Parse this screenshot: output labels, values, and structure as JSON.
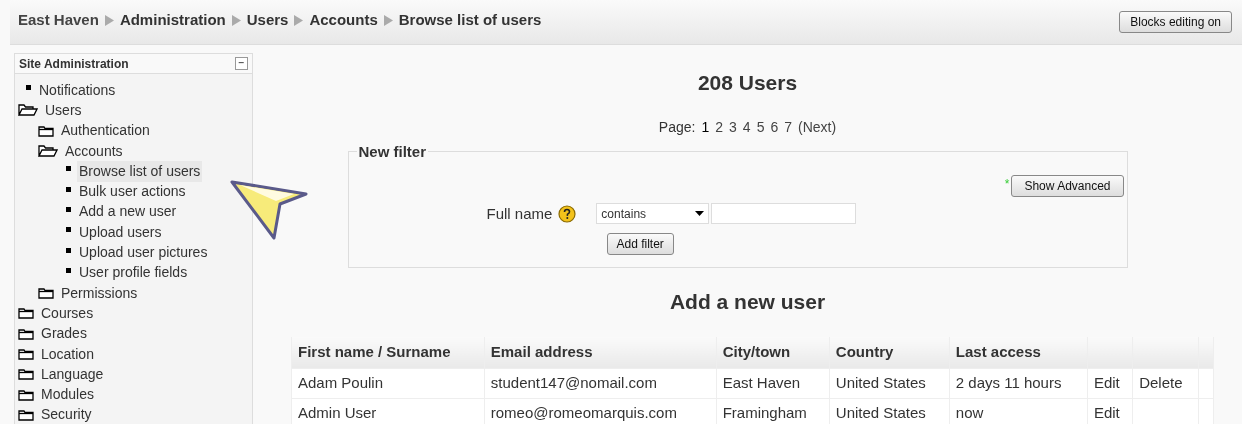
{
  "breadcrumb": [
    {
      "label": "East Haven",
      "kind": "link"
    },
    {
      "label": "Administration",
      "kind": "current"
    },
    {
      "label": "Users",
      "kind": "current"
    },
    {
      "label": "Accounts",
      "kind": "current"
    },
    {
      "label": "Browse list of users",
      "kind": "current"
    }
  ],
  "edit_button": "Blocks editing on",
  "sidebar": {
    "title": "Site Administration",
    "collapse_symbol": "−",
    "items": [
      {
        "label": "Notifications",
        "kind": "leaf",
        "selected": false
      },
      {
        "label": "Users",
        "kind": "folder",
        "expanded": true,
        "children": [
          {
            "label": "Authentication",
            "kind": "folder",
            "expanded": false
          },
          {
            "label": "Accounts",
            "kind": "folder",
            "expanded": true,
            "children": [
              {
                "label": "Browse list of users",
                "kind": "leaf",
                "selected": true
              },
              {
                "label": "Bulk user actions",
                "kind": "leaf",
                "selected": false
              },
              {
                "label": "Add a new user",
                "kind": "leaf",
                "selected": false
              },
              {
                "label": "Upload users",
                "kind": "leaf",
                "selected": false
              },
              {
                "label": "Upload user pictures",
                "kind": "leaf",
                "selected": false
              },
              {
                "label": "User profile fields",
                "kind": "leaf",
                "selected": false
              }
            ]
          },
          {
            "label": "Permissions",
            "kind": "folder",
            "expanded": false
          }
        ]
      },
      {
        "label": "Courses",
        "kind": "folder",
        "expanded": false
      },
      {
        "label": "Grades",
        "kind": "folder",
        "expanded": false
      },
      {
        "label": "Location",
        "kind": "folder",
        "expanded": false
      },
      {
        "label": "Language",
        "kind": "folder",
        "expanded": false
      },
      {
        "label": "Modules",
        "kind": "folder",
        "expanded": false
      },
      {
        "label": "Security",
        "kind": "folder",
        "expanded": false
      }
    ]
  },
  "heading": "208 Users",
  "pagination": {
    "label": "Page:",
    "pages": [
      {
        "label": "1",
        "selected": true
      },
      {
        "label": "2",
        "selected": false
      },
      {
        "label": "3",
        "selected": false
      },
      {
        "label": "4",
        "selected": false
      },
      {
        "label": "5",
        "selected": false
      },
      {
        "label": "6",
        "selected": false
      },
      {
        "label": "7",
        "selected": false
      }
    ],
    "next": "(Next)"
  },
  "filter": {
    "legend": "New filter",
    "advanced_marker": "*",
    "advanced_button": "Show Advanced",
    "field_label": "Full name",
    "operator": "contains",
    "add_button": "Add filter"
  },
  "add_user_link": "Add a new user",
  "table": {
    "columns": [
      "First name / Surname",
      "Email address",
      "City/town",
      "Country",
      "Last access"
    ],
    "rows": [
      {
        "name": "Adam Poulin",
        "email": "student147@nomail.com",
        "city": "East Haven",
        "country": "United States",
        "last_access": "2 days 11 hours",
        "actions": [
          "Edit",
          "Delete"
        ]
      },
      {
        "name": "Admin User",
        "email": "romeo@romeomarquis.com",
        "city": "Framingham",
        "country": "United States",
        "last_access": "now",
        "actions": [
          "Edit"
        ]
      }
    ]
  }
}
